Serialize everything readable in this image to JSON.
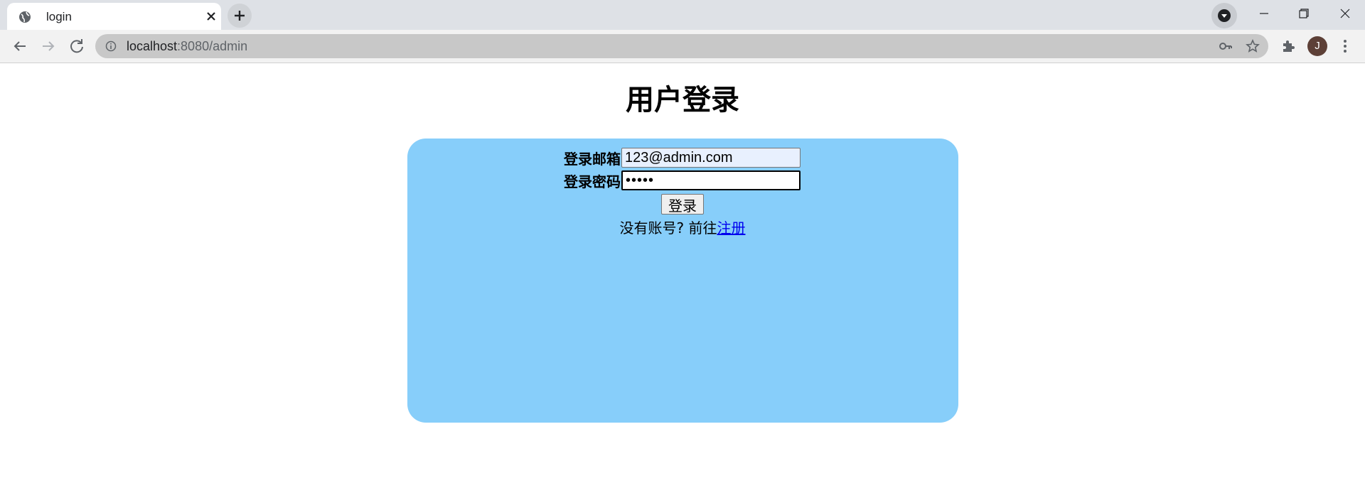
{
  "browser": {
    "tab_title": "login",
    "url_host": "localhost",
    "url_path": ":8080/admin",
    "avatar_initial": "J"
  },
  "page": {
    "heading": "用户登录",
    "email_label": "登录邮箱",
    "email_value": "123@admin.com",
    "password_label": "登录密码",
    "password_value": "12345",
    "login_button": "登录",
    "register_prompt": "没有账号? 前往",
    "register_link": "注册"
  },
  "colors": {
    "panel": "#87cefa",
    "link": "#0000ee",
    "autofill": "#e8f0fe"
  }
}
